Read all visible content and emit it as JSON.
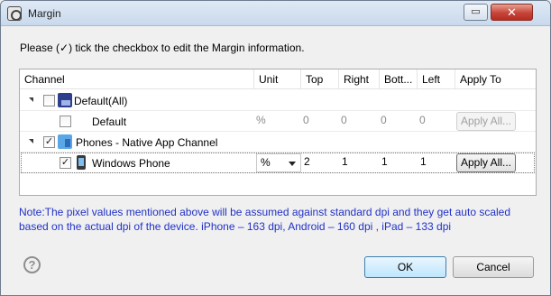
{
  "window": {
    "title": "Margin",
    "restore_glyph": "▭",
    "close_glyph": "✕"
  },
  "instruction": "Please (✓) tick the checkbox to edit the Margin information.",
  "table": {
    "headers": [
      "Channel",
      "Unit",
      "Top",
      "Right",
      "Bott...",
      "Left",
      "Apply To"
    ],
    "rows": [
      {
        "label": "Default(All)",
        "checked": false,
        "expanded": true,
        "icon": "default-channel-icon"
      },
      {
        "label": "Default",
        "checked": false,
        "unit": "%",
        "top": "0",
        "right": "0",
        "bottom": "0",
        "left": "0",
        "apply": "Apply All...",
        "apply_enabled": false
      },
      {
        "label": "Phones - Native App Channel",
        "checked": true,
        "expanded": true,
        "icon": "phones-channel-icon"
      },
      {
        "label": "Windows Phone",
        "checked": true,
        "unit": "%",
        "top": "2",
        "right": "1",
        "bottom": "1",
        "left": "1",
        "apply": "Apply All...",
        "apply_enabled": true,
        "icon": "windows-phone-icon"
      }
    ]
  },
  "note": "Note:The pixel values mentioned above will be assumed against standard dpi and they get auto scaled based on the actual dpi of the device. iPhone – 163 dpi,  Android – 160 dpi , iPad – 133 dpi",
  "footer": {
    "help_glyph": "?",
    "ok_label": "OK",
    "cancel_label": "Cancel"
  },
  "colors": {
    "note_text": "#2132c7",
    "title_bar": "#c9d9ec",
    "close_button": "#c7443a"
  }
}
